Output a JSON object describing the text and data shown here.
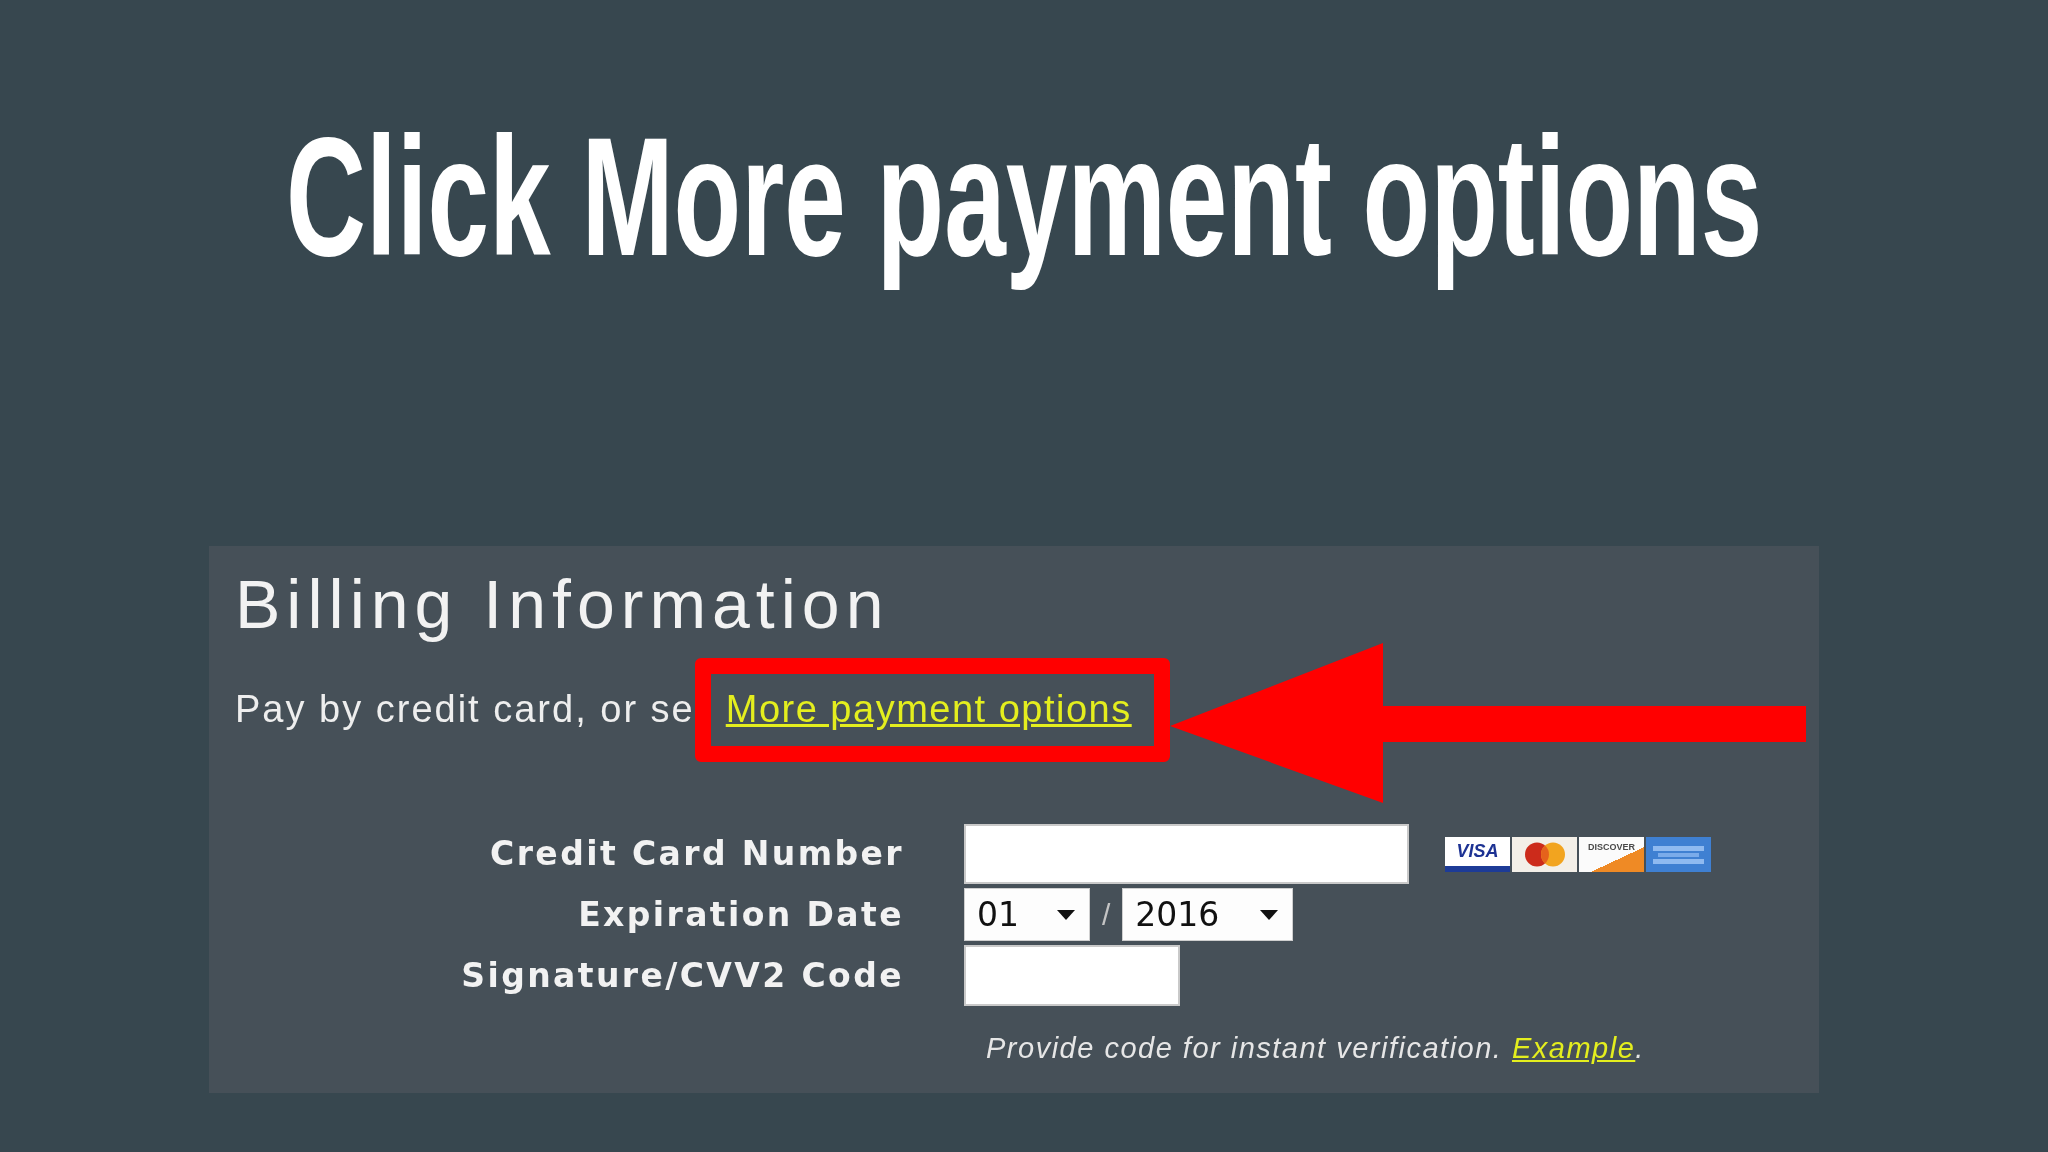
{
  "slide_title": "Click More payment options",
  "billing": {
    "heading": "Billing Information",
    "intro": {
      "text": "Pay by credit card, or se",
      "link": "More payment options",
      "highlighted": true
    },
    "fields": [
      {
        "kind": "card_number",
        "label": "Credit Card Number",
        "card_logos": [
          {
            "kind": "visa",
            "label": "VISA"
          },
          {
            "kind": "mastercard"
          },
          {
            "kind": "discover",
            "label": "DISCOVER"
          },
          {
            "kind": "amex"
          }
        ]
      },
      {
        "kind": "expiry",
        "label": "Expiration Date",
        "month": "01",
        "separator": "/",
        "year": "2016"
      },
      {
        "kind": "security_code",
        "label": "Signature/CVV2 Code"
      }
    ],
    "hint": {
      "text": "Provide code for instant verification.",
      "link": "Example",
      "end": "."
    }
  }
}
